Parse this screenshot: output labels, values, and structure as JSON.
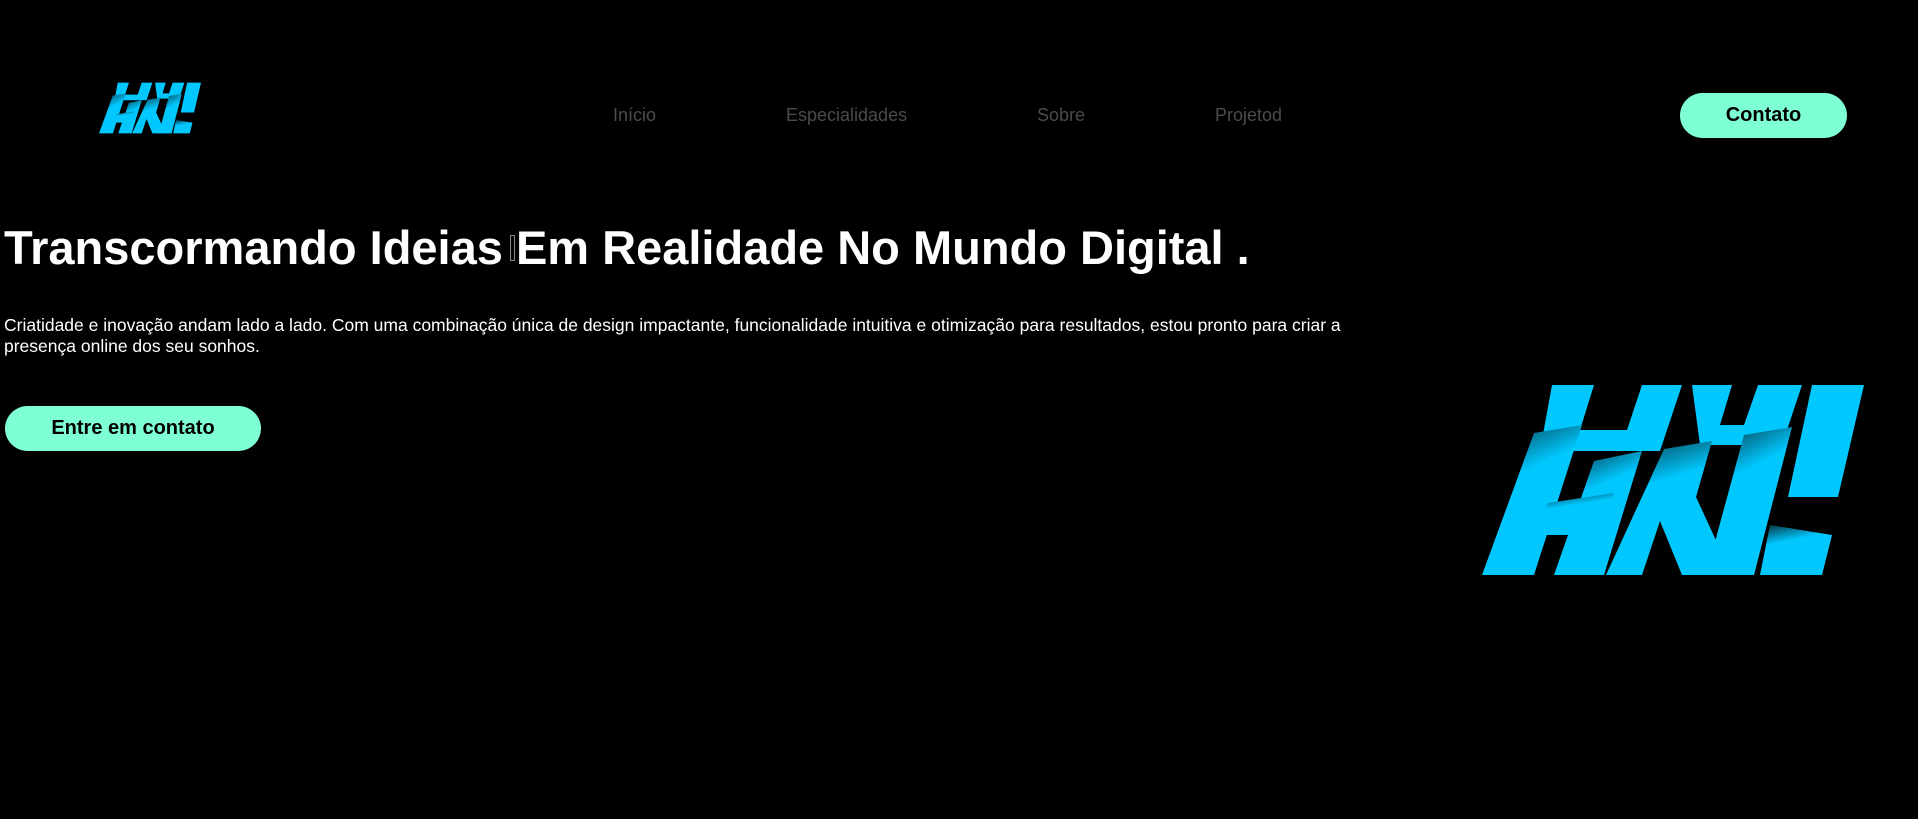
{
  "header": {
    "logo_icon": "hnl-logo",
    "nav": [
      {
        "label": "Início"
      },
      {
        "label": "Especialidades"
      },
      {
        "label": "Sobre"
      },
      {
        "label": "Projetod"
      }
    ],
    "contact_label": "Contato"
  },
  "hero": {
    "title_part1": "Transcormando Ideias ",
    "title_part2": "Em Realidade No Mundo Digital .",
    "description": "Criatidade e inovação andam lado a lado. Com uma combinação única de design impactante, funcionalidade intuitiva e otimização para resultados, estou pronto para criar a presença online dos seu sonhos.",
    "cta_label": "Entre em contato",
    "illustration_icon": "hnl-logo"
  },
  "colors": {
    "background": "#000000",
    "accent": "#7fffd4",
    "logo": "#00c8ff",
    "nav_text": "#4b4b4b",
    "text": "#ffffff"
  }
}
